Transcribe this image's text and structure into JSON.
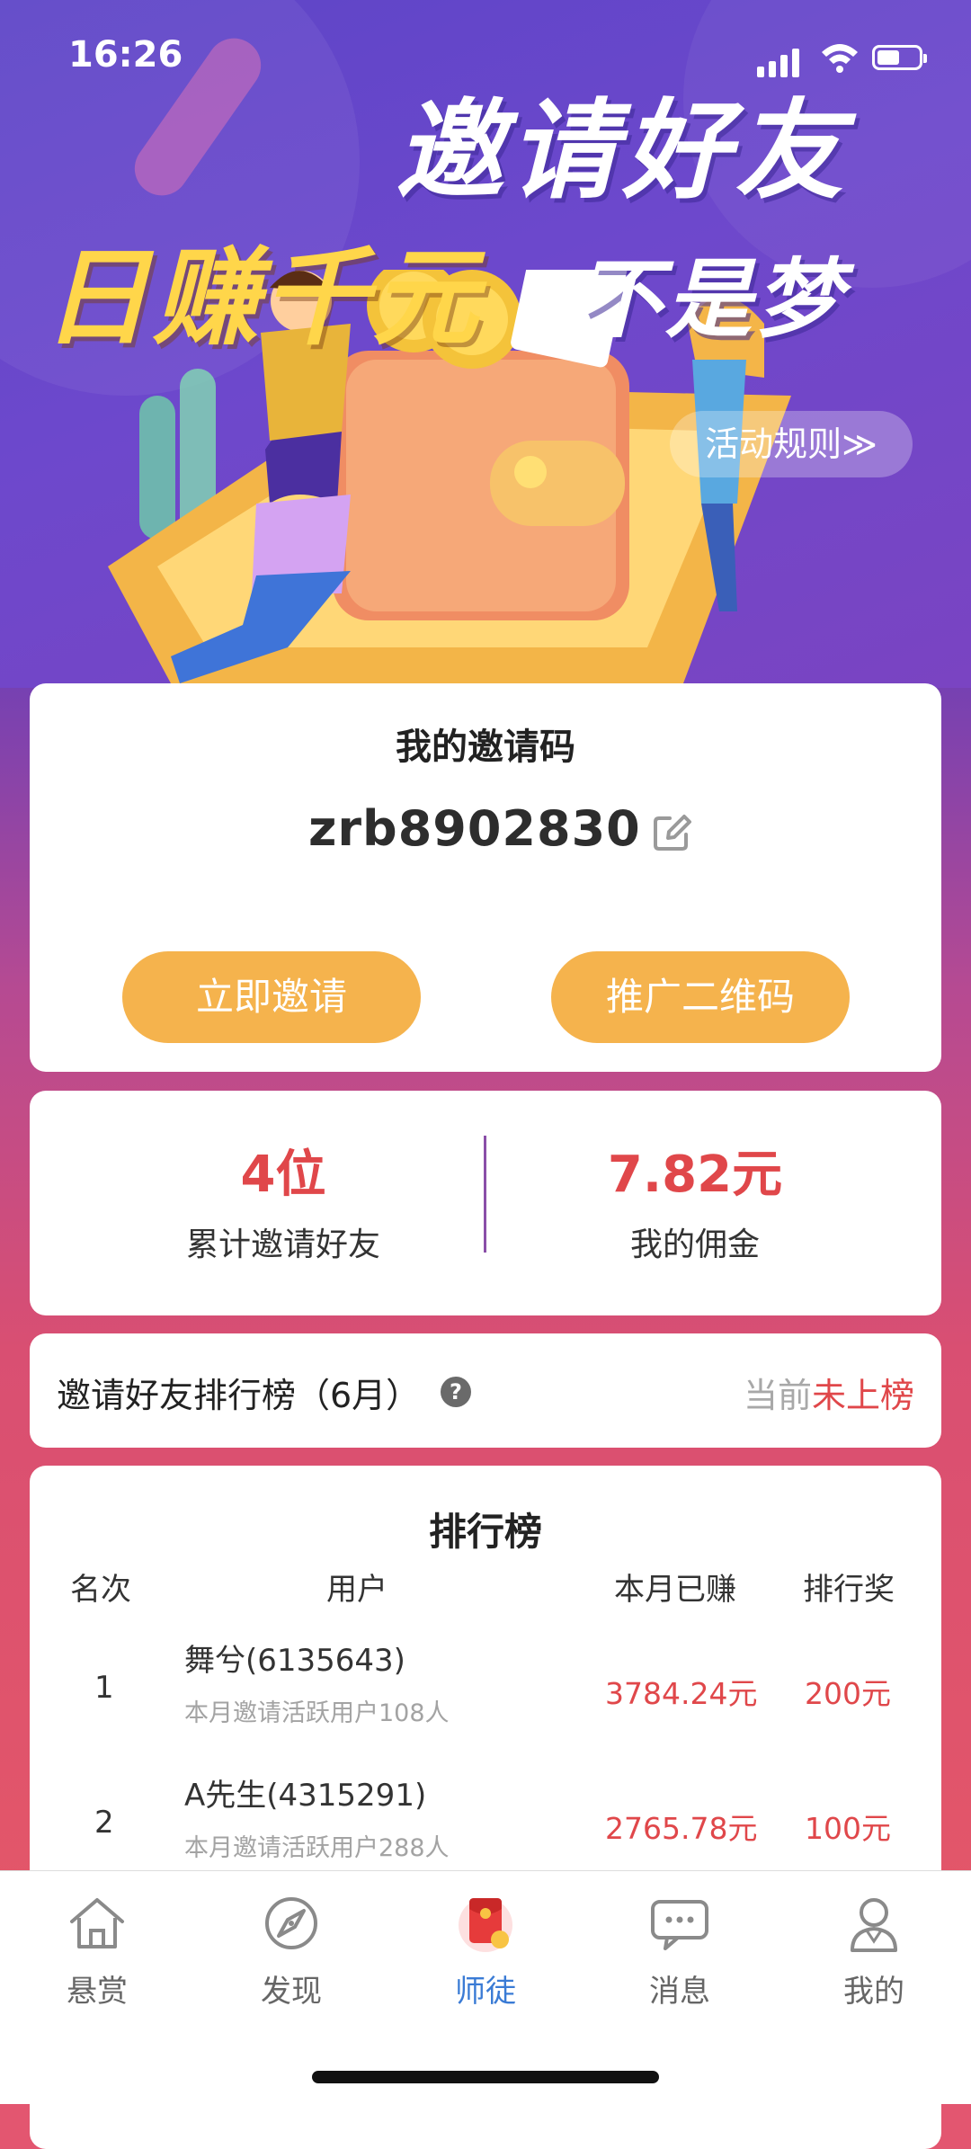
{
  "status_bar": {
    "time": "16:26"
  },
  "banner": {
    "title_line1": "邀请好友",
    "title_line2": "日赚千元",
    "title_line3": "不是梦",
    "rules_button": "活动规则≫"
  },
  "invite": {
    "title": "我的邀请码",
    "code": "zrb8902830",
    "invite_button": "立即邀请",
    "qr_button": "推广二维码"
  },
  "stats": {
    "invited_value": "4位",
    "invited_label": "累计邀请好友",
    "commission_value": "7.82元",
    "commission_label": "我的佣金"
  },
  "ranking_header": {
    "title": "邀请好友排行榜（6月）",
    "help_icon": "?",
    "status_prefix": "当前",
    "status_value": "未上榜"
  },
  "leaderboard": {
    "title": "排行榜",
    "columns": [
      "名次",
      "用户",
      "本月已赚",
      "排行奖"
    ],
    "rows": [
      {
        "rank": "1",
        "user": "舞兮(6135643)",
        "detail": "本月邀请活跃用户108人",
        "earned": "3784.24元",
        "reward": "200元"
      },
      {
        "rank": "2",
        "user": "A先生(4315291)",
        "detail": "本月邀请活跃用户288人",
        "earned": "2765.78元",
        "reward": "100元"
      }
    ]
  },
  "tab_bar": {
    "items": [
      {
        "label": "悬赏",
        "icon": "home-icon"
      },
      {
        "label": "发现",
        "icon": "compass-icon"
      },
      {
        "label": "师徒",
        "icon": "red-envelope-icon"
      },
      {
        "label": "消息",
        "icon": "chat-icon"
      },
      {
        "label": "我的",
        "icon": "profile-icon"
      }
    ],
    "active_index": 2
  },
  "colors": {
    "accent_orange": "#f5b34d",
    "highlight_red": "#e0474a",
    "active_tab_blue": "#3a7bd5"
  }
}
